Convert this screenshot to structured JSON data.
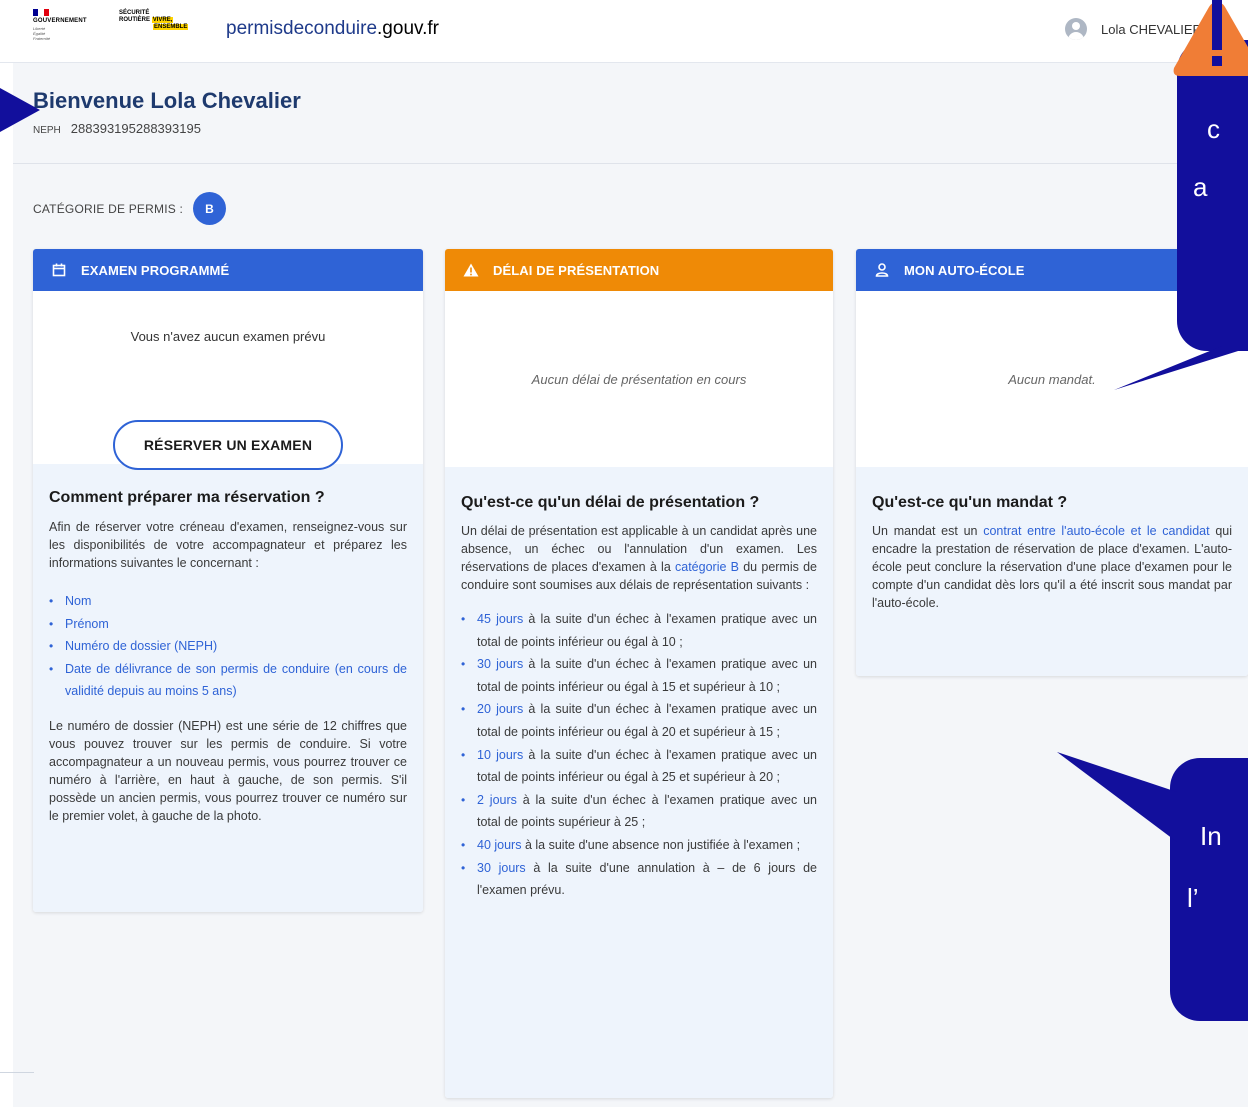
{
  "header": {
    "gov_text": "GOUVERNEMENT",
    "gov_motto": [
      "Liberté",
      "Égalité",
      "Fraternité"
    ],
    "secu_line1": "SÉCURITÉ",
    "secu_line2": "ROUTIÈRE",
    "secu_line2_hl": "VIVRE,",
    "secu_line3": "ENSEMBLE",
    "site_prefix": "permisdeconduire",
    "site_suffix": ".gouv.fr",
    "user_name": "Lola CHEVALIER"
  },
  "welcome": {
    "title": "Bienvenue Lola Chevalier",
    "neph_label": "NEPH",
    "neph_value": "288393195288393195"
  },
  "category": {
    "label": "CATÉGORIE DE PERMIS :",
    "value": "B"
  },
  "cards": {
    "exam": {
      "title": "EXAMEN PROGRAMMÉ",
      "empty_text": "Vous n'avez aucun examen prévu",
      "button_label": "RÉSERVER UN EXAMEN",
      "info_title": "Comment préparer ma réservation ?",
      "info_intro": "Afin de réserver votre créneau d'examen, renseignez-vous sur les disponibilités de votre accompagnateur et préparez les informations suivantes le concernant :",
      "items": [
        "Nom",
        "Prénom",
        "Numéro de dossier (NEPH)",
        "Date de délivrance de son permis de conduire (en cours de validité depuis au moins 5 ans)"
      ],
      "info_outro": "Le numéro de dossier (NEPH) est une série de 12 chiffres que vous pouvez trouver sur les permis de conduire. Si votre accompagnateur a un nouveau permis, vous pourrez trouver ce numéro à l'arrière, en haut à gauche, de son permis. S'il possède un ancien permis, vous pourrez trouver ce numéro sur le premier volet, à gauche de la photo."
    },
    "delay": {
      "title": "DÉLAI DE PRÉSENTATION",
      "empty_text": "Aucun délai de présentation en cours",
      "info_title": "Qu'est-ce qu'un délai de présentation ?",
      "info_intro_a": "Un délai de présentation est applicable à un candidat après une absence, un échec ou l'annulation d'un examen. Les réservations de places d'examen à la ",
      "info_intro_link": "catégorie B",
      "info_intro_b": " du permis de conduire sont soumises aux délais de représentation suivants :",
      "items": [
        {
          "link": "45 jours",
          "text": " à la suite d'un échec à l'examen pratique avec un total de points inférieur ou égal à 10 ;"
        },
        {
          "link": "30 jours",
          "text": " à la suite d'un échec à l'examen pratique avec un total de points inférieur ou égal à 15 et supérieur à 10 ;"
        },
        {
          "link": "20 jours",
          "text": " à la suite d'un échec à l'examen pratique avec un total de points inférieur ou égal à 20 et supérieur à 15 ;"
        },
        {
          "link": "10 jours",
          "text": " à la suite d'un échec à l'examen pratique avec un total de points inférieur ou égal à 25 et supérieur à 20 ;"
        },
        {
          "link": "2 jours",
          "text": " à la suite d'un échec à l'examen pratique avec un total de points supérieur à 25 ;"
        },
        {
          "link": "40 jours",
          "text": " à la suite d'une absence non justifiée à l'examen ;"
        },
        {
          "link": "30 jours",
          "text": " à la suite d'une annulation à – de 6 jours de l'examen prévu."
        }
      ]
    },
    "school": {
      "title": "MON AUTO-ÉCOLE",
      "empty_text": "Aucun mandat.",
      "info_title": "Qu'est-ce qu'un mandat ?",
      "info_a": "Un mandat est un ",
      "info_link": "contrat entre l'auto-école et le candidat",
      "info_b": " qui encadre la prestation de réservation de place d'examen. L'auto-école peut conclure la réservation d'une place d'examen pour le compte d'un candidat dès lors qu'il a été inscrit sous mandat par l'auto-école."
    }
  },
  "overlay": {
    "warning_symbol": "!",
    "top_lines": [
      "c",
      "a"
    ],
    "bottom_lines": [
      "In",
      "l’"
    ],
    "colors": {
      "callout": "#120f9c",
      "warning": "#f07d36"
    }
  },
  "colors": {
    "accent_blue": "#2f63d6",
    "warning_orange": "#ef8a06",
    "page_bg": "#f4f6f9",
    "info_bg": "#eef4fc"
  }
}
